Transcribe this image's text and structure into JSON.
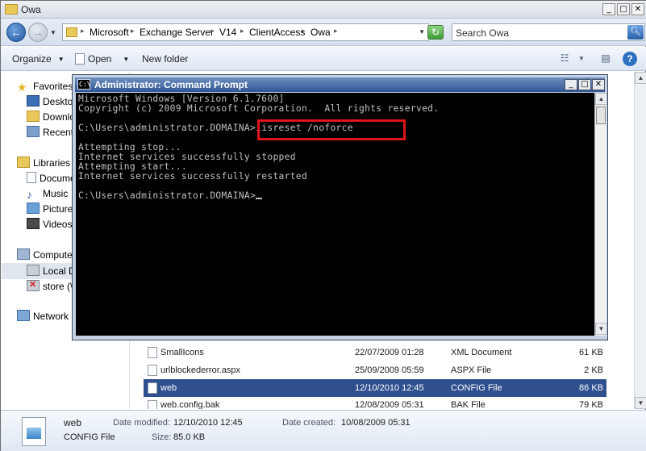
{
  "explorer": {
    "title": "Owa",
    "caption_buttons": [
      "_",
      "□",
      "✕"
    ],
    "breadcrumb": [
      "Microsoft",
      "Exchange Server",
      "V14",
      "ClientAccess",
      "Owa"
    ],
    "search_placeholder": "Search Owa",
    "toolbar": {
      "organize": "Organize",
      "open": "Open",
      "new_folder": "New folder",
      "help": "?"
    },
    "nav": {
      "favorites": "Favorites",
      "desktop": "Desktop",
      "downloads": "Downloa",
      "recent": "Recent",
      "libraries": "Libraries",
      "documents": "Docume",
      "music": "Music",
      "pictures": "Pictures",
      "videos": "Videos",
      "computer": "Computer",
      "local_disk": "Local Dis",
      "store": "store (\\",
      "network": "Network"
    },
    "files": [
      {
        "name": "SmallIcons",
        "date": "22/07/2009 01:28",
        "type": "XML Document",
        "size": "61 KB",
        "selected": false
      },
      {
        "name": "urlblockederror.aspx",
        "date": "25/09/2009 05:59",
        "type": "ASPX File",
        "size": "2 KB",
        "selected": false
      },
      {
        "name": "web",
        "date": "12/10/2010 12:45",
        "type": "CONFIG File",
        "size": "86 KB",
        "selected": true
      },
      {
        "name": "web.config.bak",
        "date": "12/08/2009 05:31",
        "type": "BAK File",
        "size": "79 KB",
        "selected": false
      }
    ],
    "details": {
      "name": "web",
      "type": "CONFIG File",
      "modified_label": "Date modified:",
      "modified": "12/10/2010 12:45",
      "created_label": "Date created:",
      "created": "10/08/2009 05:31",
      "size_label": "Size:",
      "size": "85.0 KB"
    }
  },
  "cmd": {
    "title": "Administrator: Command Prompt",
    "icon_text": "C:\\",
    "lines": [
      "Microsoft Windows [Version 6.1.7600]",
      "Copyright (c) 2009 Microsoft Corporation.  All rights reserved.",
      "",
      "C:\\Users\\administrator.DOMAINA>iisreset /noforce",
      "",
      "Attempting stop...",
      "Internet services successfully stopped",
      "Attempting start...",
      "Internet services successfully restarted",
      "",
      "C:\\Users\\administrator.DOMAINA>"
    ]
  },
  "colors": {
    "highlight_box": "#e0141b",
    "console_bg": "#000000",
    "console_fg": "#c0c0c0",
    "selection": "#2f4f8f"
  }
}
